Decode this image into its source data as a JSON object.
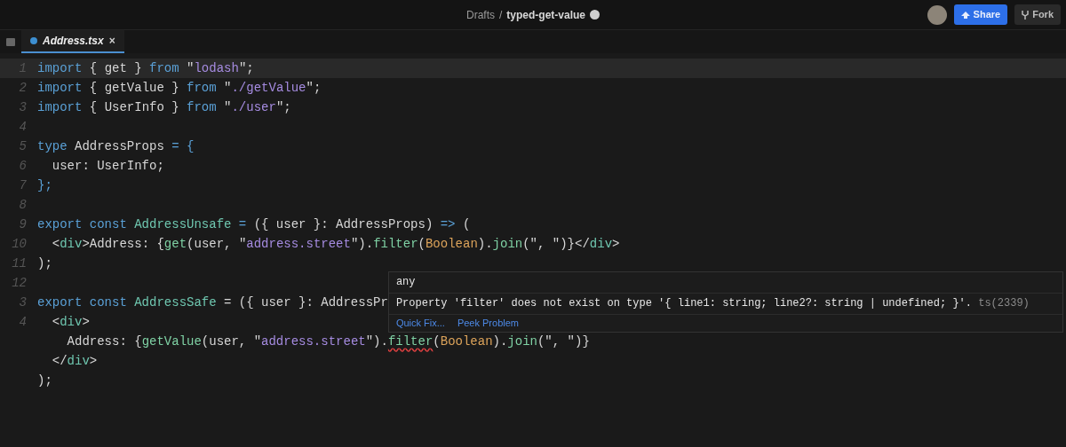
{
  "header": {
    "breadcrumb": [
      "Drafts",
      "/",
      "typed-get-value"
    ],
    "buttons": [
      {
        "kind": "primary",
        "label": "Share"
      },
      {
        "kind": "secondary",
        "label": "Fork"
      }
    ]
  },
  "tabs": [
    {
      "label": "Address.tsx",
      "close": "×",
      "selected": true
    }
  ],
  "editor": {
    "lines": [
      {
        "number": "1",
        "current": true,
        "tokens": [
          {
            "kind": "keyword",
            "text": "import"
          },
          {
            "kind": "plain",
            "text": " { get } "
          },
          {
            "kind": "keyword",
            "text": "from"
          },
          {
            "kind": "plain",
            "text": " \""
          },
          {
            "kind": "string",
            "text": "lodash"
          },
          {
            "kind": "plain",
            "text": "\";"
          }
        ]
      },
      {
        "number": "2",
        "current": false,
        "tokens": [
          {
            "kind": "keyword",
            "text": "import"
          },
          {
            "kind": "plain",
            "text": " { getValue } "
          },
          {
            "kind": "keyword",
            "text": "from"
          },
          {
            "kind": "plain",
            "text": " \""
          },
          {
            "kind": "string",
            "text": "./getValue"
          },
          {
            "kind": "plain",
            "text": "\";"
          }
        ]
      },
      {
        "number": "3",
        "current": false,
        "tokens": [
          {
            "kind": "keyword",
            "text": "import"
          },
          {
            "kind": "plain",
            "text": " { UserInfo } "
          },
          {
            "kind": "keyword",
            "text": "from"
          },
          {
            "kind": "plain",
            "text": " \""
          },
          {
            "kind": "string",
            "text": "./user"
          },
          {
            "kind": "plain",
            "text": "\";"
          }
        ]
      },
      {
        "number": "4",
        "current": false
      },
      {
        "number": "5",
        "current": false,
        "tokens": [
          {
            "kind": "keyword",
            "text": "type"
          },
          {
            "kind": "plain",
            "text": " AddressProps "
          },
          {
            "kind": "keyword",
            "text": "= {"
          }
        ]
      },
      {
        "number": "6",
        "current": false,
        "tokens": [
          {
            "kind": "plain",
            "text": "  user: UserInfo;"
          }
        ]
      },
      {
        "number": "7",
        "current": false,
        "tokens": [
          {
            "kind": "keyword",
            "text": "};"
          }
        ]
      },
      {
        "number": "8",
        "current": false
      },
      {
        "number": "9",
        "current": false,
        "tokens": [
          {
            "kind": "keyword",
            "text": "export const "
          },
          {
            "kind": "component",
            "text": "AddressUnsafe"
          },
          {
            "kind": "keyword",
            "text": " ="
          },
          {
            "kind": "plain",
            "text": " ({ user }: AddressProps) "
          },
          {
            "kind": "keyword",
            "text": "=>"
          },
          {
            "kind": "plain",
            "text": " ("
          }
        ]
      },
      {
        "number": "10",
        "current": false,
        "tokens": [
          {
            "kind": "plain",
            "text": "  <"
          },
          {
            "kind": "tag",
            "text": "div"
          },
          {
            "kind": "plain",
            "text": ">Address: {"
          },
          {
            "kind": "function",
            "text": "get"
          },
          {
            "kind": "plain",
            "text": "(user, \""
          },
          {
            "kind": "string",
            "text": "address.street"
          },
          {
            "kind": "plain",
            "text": "\")."
          },
          {
            "kind": "function",
            "text": "filter"
          },
          {
            "kind": "plain",
            "text": "("
          },
          {
            "kind": "builtin",
            "text": "Boolean"
          },
          {
            "kind": "plain",
            "text": ")."
          },
          {
            "kind": "function",
            "text": "join"
          },
          {
            "kind": "plain",
            "text": "(\", \")}</"
          },
          {
            "kind": "tag",
            "text": "div"
          },
          {
            "kind": "plain",
            "text": ">"
          }
        ]
      },
      {
        "number": "11",
        "current": false,
        "tokens": [
          {
            "kind": "plain",
            "text": ");"
          }
        ]
      },
      {
        "number": "12",
        "current": false
      },
      {
        "number": "3",
        "current": false,
        "tokens": [
          {
            "kind": "keyword",
            "text": "export const "
          },
          {
            "kind": "component",
            "text": "AddressSafe"
          },
          {
            "kind": "plain",
            "text": " = ({ user }: AddressPr"
          }
        ],
        "hover": {
          "type": "any",
          "message": "Property 'filter' does not exist on type '{ line1: string; line2?: string | undefined; }'.",
          "code": "ts(2339)",
          "actions": [
            "Quick Fix...",
            "Peek Problem"
          ]
        }
      },
      {
        "number": "4",
        "current": false,
        "tokens": [
          {
            "kind": "plain",
            "text": "  <"
          },
          {
            "kind": "tag",
            "text": "div"
          },
          {
            "kind": "plain",
            "text": ">"
          }
        ]
      },
      {
        "current": false,
        "tokens": [
          {
            "kind": "plain",
            "text": "    Address: {"
          },
          {
            "kind": "function",
            "text": "getValue"
          },
          {
            "kind": "plain",
            "text": "(user, \""
          },
          {
            "kind": "string",
            "text": "address.street"
          },
          {
            "kind": "plain",
            "text": "\")."
          },
          {
            "kind": "function",
            "text": "filter",
            "error": true
          },
          {
            "kind": "plain",
            "text": "("
          },
          {
            "kind": "builtin",
            "text": "Boolean"
          },
          {
            "kind": "plain",
            "text": ")."
          },
          {
            "kind": "function",
            "text": "join"
          },
          {
            "kind": "plain",
            "text": "(\", \")}"
          }
        ]
      },
      {
        "current": false,
        "tokens": [
          {
            "kind": "plain",
            "text": "  </"
          },
          {
            "kind": "tag",
            "text": "div"
          },
          {
            "kind": "plain",
            "text": ">"
          }
        ]
      },
      {
        "current": false,
        "tokens": [
          {
            "kind": "plain",
            "text": ");"
          }
        ]
      }
    ]
  }
}
